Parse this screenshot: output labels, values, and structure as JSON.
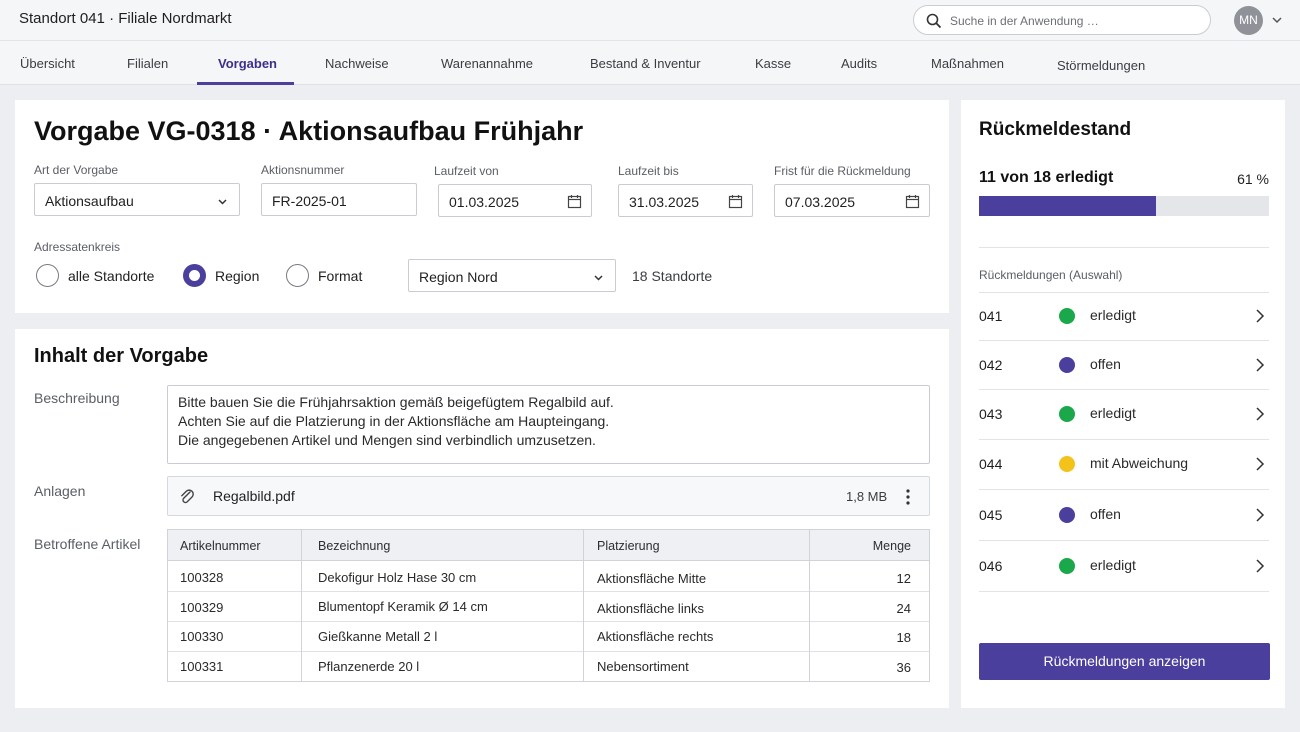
{
  "app": {
    "title": "Standort 041 · Filiale Nordmarkt"
  },
  "search": {
    "placeholder": "Suche in der Anwendung …",
    "icon": "search-icon"
  },
  "user": {
    "initials": "MN"
  },
  "tabs": [
    {
      "label": "Übersicht"
    },
    {
      "label": "Filialen"
    },
    {
      "label": "Vorgaben",
      "active": true
    },
    {
      "label": "Nachweise"
    },
    {
      "label": "Warenannahme"
    },
    {
      "label": "Bestand & Inventur"
    },
    {
      "label": "Kasse"
    },
    {
      "label": "Audits"
    },
    {
      "label": "Maßnahmen"
    },
    {
      "label": "Störmeldungen"
    }
  ],
  "colors": {
    "accent": "#4b3f9e",
    "done": "#1aa84a",
    "open": "#4b3f9e",
    "deviation": "#f3c21b"
  },
  "header": {
    "title": "Vorgabe VG-0318 · Aktionsaufbau Frühjahr",
    "type": {
      "label": "Art der Vorgabe",
      "value": "Aktionsaufbau"
    },
    "action_no": {
      "label": "Aktionsnummer",
      "value": "FR-2025-01"
    },
    "from": {
      "label": "Laufzeit von",
      "value": "01.03.2025"
    },
    "to": {
      "label": "Laufzeit bis",
      "value": "31.03.2025"
    },
    "deadline": {
      "label": "Frist für die Rückmeldung",
      "value": "07.03.2025"
    },
    "recipients": {
      "label": "Adressatenkreis",
      "options": [
        "alle Standorte",
        "Region",
        "Format"
      ],
      "selected": "Region",
      "region_value": "Region Nord",
      "count": "18 Standorte"
    }
  },
  "content": {
    "title": "Inhalt der Vorgabe",
    "description_label": "Beschreibung",
    "description_lines": [
      "Bitte bauen Sie die Frühjahrsaktion gemäß beigefügtem Regalbild auf.",
      "Achten Sie auf die Platzierung in der Aktionsfläche am Haupteingang.",
      "Die angegebenen Artikel und Mengen sind verbindlich umzusetzen."
    ],
    "attachments_label": "Anlagen",
    "attachment": {
      "name": "Regalbild.pdf",
      "size": "1,8 MB"
    },
    "articles_label": "Betroffene Artikel",
    "columns": [
      "Artikelnummer",
      "Bezeichnung",
      "Platzierung",
      "Menge"
    ],
    "rows": [
      [
        "100328",
        "Dekofigur Holz Hase 30 cm",
        "Aktionsfläche Mitte",
        "12"
      ],
      [
        "100329",
        "Blumentopf Keramik Ø 14 cm",
        "Aktionsfläche links",
        "24"
      ],
      [
        "100330",
        "Gießkanne Metall 2 l",
        "Aktionsfläche rechts",
        "18"
      ],
      [
        "100331",
        "Pflanzenerde 20 l",
        "Nebensortiment",
        "36"
      ]
    ]
  },
  "feedback": {
    "title": "Rückmeldestand",
    "summary": "11 von 18 erledigt",
    "percent_label": "61 %",
    "progress": 0.61,
    "list_label": "Rückmeldungen (Auswahl)",
    "items": [
      {
        "id": "041",
        "status": "erledigt",
        "color": "#1aa84a"
      },
      {
        "id": "042",
        "status": "offen",
        "color": "#4b3f9e"
      },
      {
        "id": "043",
        "status": "erledigt",
        "color": "#1aa84a"
      },
      {
        "id": "044",
        "status": "mit Abweichung",
        "color": "#f3c21b"
      },
      {
        "id": "045",
        "status": "offen",
        "color": "#4b3f9e"
      },
      {
        "id": "046",
        "status": "erledigt",
        "color": "#1aa84a"
      }
    ],
    "button": "Rückmeldungen anzeigen"
  }
}
